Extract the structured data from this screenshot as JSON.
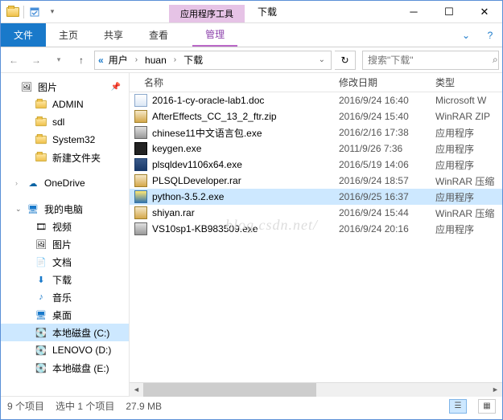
{
  "titlebar": {
    "context_tab": "应用程序工具",
    "title": "下载"
  },
  "ribbon": {
    "file": "文件",
    "home": "主页",
    "share": "共享",
    "view": "查看",
    "manage": "管理"
  },
  "address": {
    "crumbs": [
      "用户",
      "huan",
      "下载"
    ],
    "search_placeholder": "搜索\"下载\""
  },
  "nav": {
    "pictures": "图片",
    "admin": "ADMIN",
    "sdl": "sdl",
    "system32": "System32",
    "newfolder": "新建文件夹",
    "onedrive": "OneDrive",
    "thispc": "我的电脑",
    "videos": "视频",
    "pictures2": "图片",
    "documents": "文档",
    "downloads": "下载",
    "music": "音乐",
    "desktop": "桌面",
    "diskc": "本地磁盘 (C:)",
    "diskd": "LENOVO (D:)",
    "diske": "本地磁盘 (E:)"
  },
  "columns": {
    "name": "名称",
    "date": "修改日期",
    "type": "类型"
  },
  "files": [
    {
      "name": "2016-1-cy-oracle-lab1.doc",
      "date": "2016/9/24 16:40",
      "type": "Microsoft W",
      "ico": "ico-doc"
    },
    {
      "name": "AfterEffects_CC_13_2_ftr.zip",
      "date": "2016/9/24 15:40",
      "type": "WinRAR ZIP",
      "ico": "ico-zip"
    },
    {
      "name": "chinese11中文语言包.exe",
      "date": "2016/2/16 17:38",
      "type": "应用程序",
      "ico": "ico-exe"
    },
    {
      "name": "keygen.exe",
      "date": "2011/9/26 7:36",
      "type": "应用程序",
      "ico": "ico-key"
    },
    {
      "name": "plsqldev1106x64.exe",
      "date": "2016/5/19 14:06",
      "type": "应用程序",
      "ico": "ico-sql"
    },
    {
      "name": "PLSQLDeveloper.rar",
      "date": "2016/9/24 18:57",
      "type": "WinRAR 压缩",
      "ico": "ico-zip"
    },
    {
      "name": "python-3.5.2.exe",
      "date": "2016/9/25 16:37",
      "type": "应用程序",
      "ico": "ico-py",
      "selected": true
    },
    {
      "name": "shiyan.rar",
      "date": "2016/9/24 15:44",
      "type": "WinRAR 压缩",
      "ico": "ico-zip"
    },
    {
      "name": "VS10sp1-KB983509.exe",
      "date": "2016/9/24 20:16",
      "type": "应用程序",
      "ico": "ico-exe"
    }
  ],
  "status": {
    "count": "9 个项目",
    "selected": "选中 1 个项目",
    "size": "27.9 MB"
  },
  "watermark": "blog.csdn.net/"
}
